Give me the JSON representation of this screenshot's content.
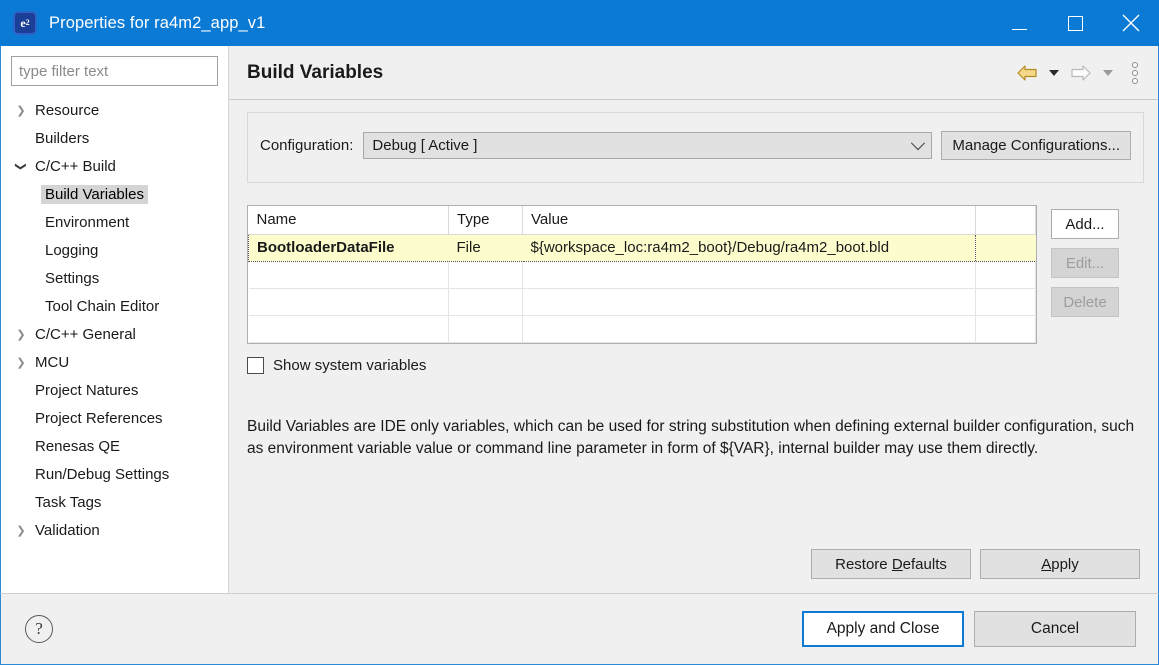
{
  "window": {
    "title": "Properties for ra4m2_app_v1",
    "icon": "eclipse-e2-icon",
    "accent_color": "#0a7ad5",
    "controls": {
      "minimize": "minimize-icon",
      "maximize": "maximize-icon",
      "close": "close-icon"
    }
  },
  "sidebar": {
    "filter": {
      "value": "",
      "placeholder": "type filter text"
    },
    "items": [
      {
        "label": "Resource",
        "indent": 0,
        "arrow": "collapsed",
        "selected": false
      },
      {
        "label": "Builders",
        "indent": 0,
        "arrow": "none",
        "selected": false
      },
      {
        "label": "C/C++ Build",
        "indent": 0,
        "arrow": "expanded",
        "selected": false
      },
      {
        "label": "Build Variables",
        "indent": 1,
        "arrow": "none",
        "selected": true
      },
      {
        "label": "Environment",
        "indent": 1,
        "arrow": "none",
        "selected": false
      },
      {
        "label": "Logging",
        "indent": 1,
        "arrow": "none",
        "selected": false
      },
      {
        "label": "Settings",
        "indent": 1,
        "arrow": "none",
        "selected": false
      },
      {
        "label": "Tool Chain Editor",
        "indent": 1,
        "arrow": "none",
        "selected": false
      },
      {
        "label": "C/C++ General",
        "indent": 0,
        "arrow": "collapsed",
        "selected": false
      },
      {
        "label": "MCU",
        "indent": 0,
        "arrow": "collapsed",
        "selected": false
      },
      {
        "label": "Project Natures",
        "indent": 0,
        "arrow": "none",
        "selected": false
      },
      {
        "label": "Project References",
        "indent": 0,
        "arrow": "none",
        "selected": false
      },
      {
        "label": "Renesas QE",
        "indent": 0,
        "arrow": "none",
        "selected": false
      },
      {
        "label": "Run/Debug Settings",
        "indent": 0,
        "arrow": "none",
        "selected": false
      },
      {
        "label": "Task Tags",
        "indent": 0,
        "arrow": "none",
        "selected": false
      },
      {
        "label": "Validation",
        "indent": 0,
        "arrow": "collapsed",
        "selected": false
      }
    ]
  },
  "header": {
    "title": "Build Variables",
    "back_icon": "back-arrow-icon",
    "forward_icon": "forward-arrow-icon",
    "menu_icon": "view-menu-icon"
  },
  "configuration": {
    "label": "Configuration:",
    "selected": "Debug  [ Active ]",
    "options": [
      "Debug  [ Active ]"
    ],
    "manage_label": "Manage Configurations..."
  },
  "table": {
    "columns": [
      "Name",
      "Type",
      "Value"
    ],
    "rows": [
      {
        "name": "BootloaderDataFile",
        "type": "File",
        "value": "${workspace_loc:ra4m2_boot}/Debug/ra4m2_boot.bld",
        "selected": true
      },
      {
        "name": "",
        "type": "",
        "value": "",
        "selected": false
      },
      {
        "name": "",
        "type": "",
        "value": "",
        "selected": false
      },
      {
        "name": "",
        "type": "",
        "value": "",
        "selected": false
      }
    ]
  },
  "side_buttons": [
    {
      "label": "Add...",
      "enabled": true
    },
    {
      "label": "Edit...",
      "enabled": false
    },
    {
      "label": "Delete",
      "enabled": false
    }
  ],
  "show_system_variables": {
    "label": "Show system variables",
    "checked": false
  },
  "description": "Build Variables are IDE only variables, which can be used for string substitution when defining external builder configuration, such as environment variable value or command line parameter in form of ${VAR}, internal builder may use them directly.",
  "page_buttons": {
    "restore_defaults": "Restore Defaults",
    "restore_defaults_mnemonic": "D",
    "apply": "Apply",
    "apply_mnemonic": "A"
  },
  "footer": {
    "help_icon": "help-question-icon",
    "apply_and_close": "Apply and Close",
    "cancel": "Cancel"
  }
}
